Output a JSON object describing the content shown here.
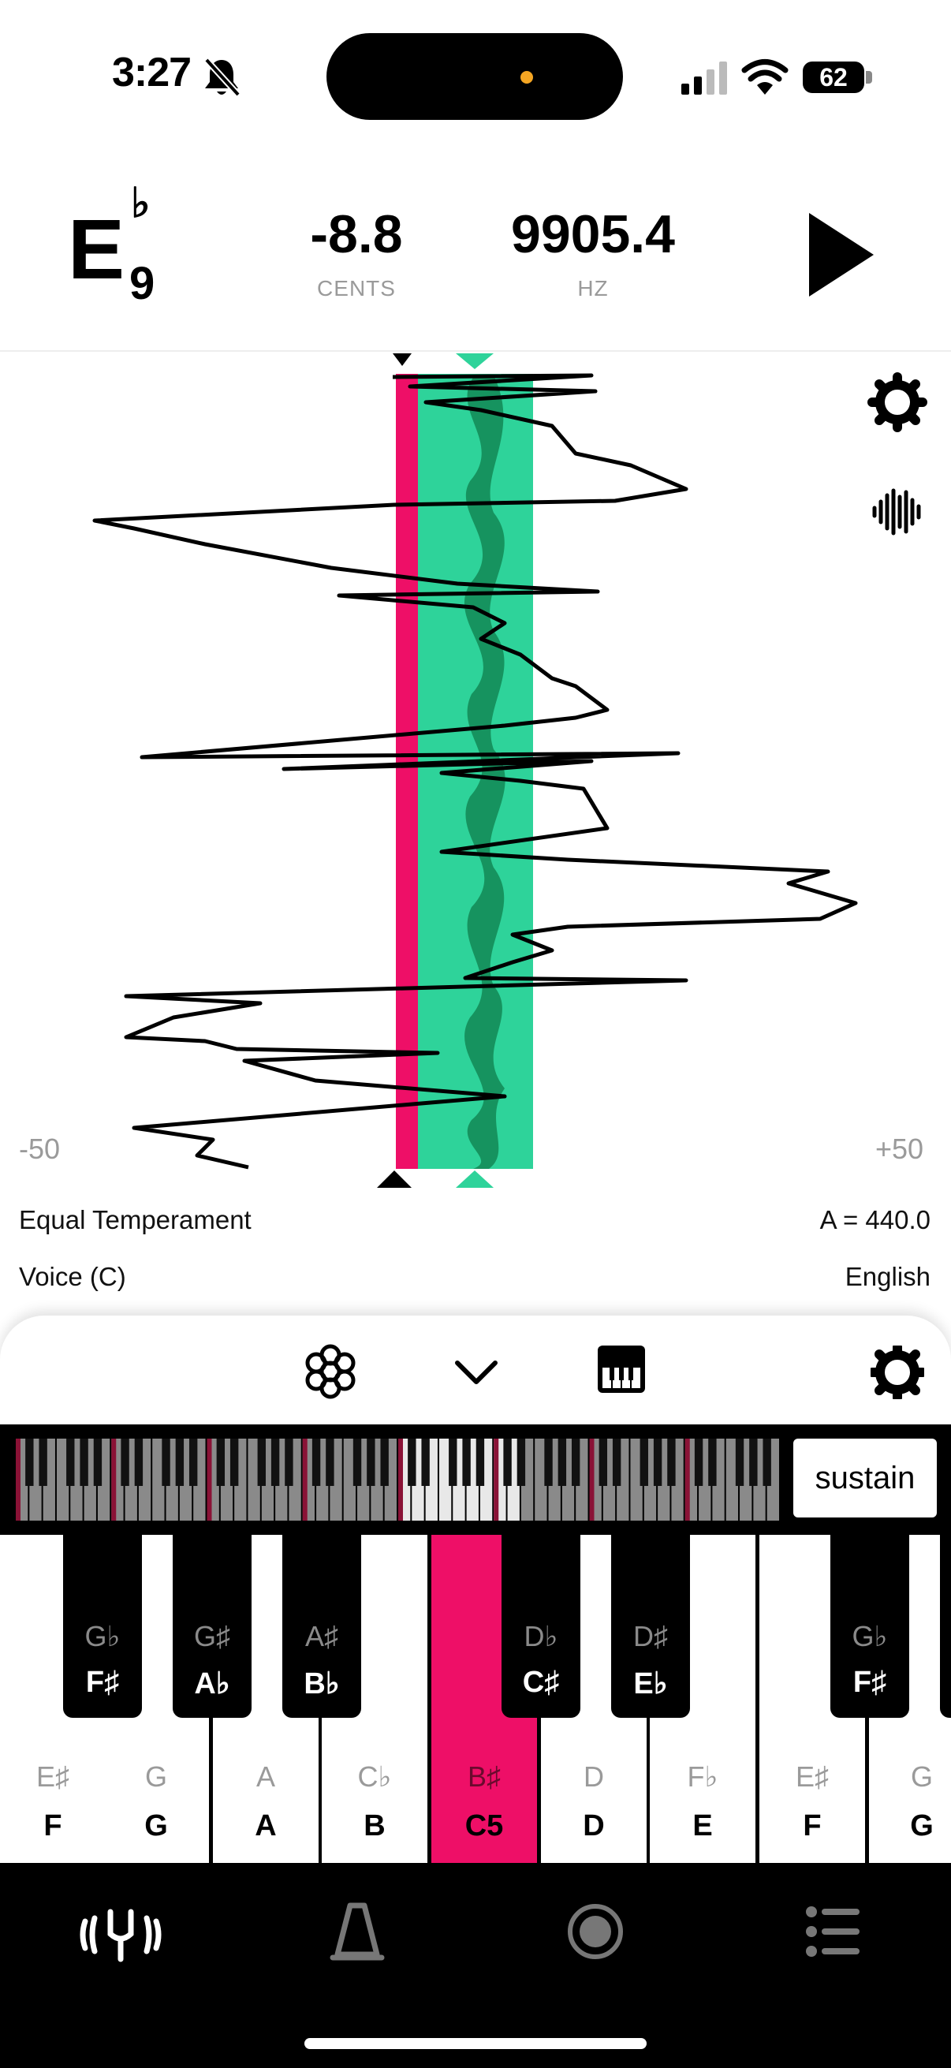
{
  "status_bar": {
    "time": "3:27",
    "battery": "62",
    "icons": [
      "bell-slash-icon",
      "signal-icon",
      "wifi-icon",
      "battery-icon"
    ]
  },
  "header": {
    "note": {
      "letter": "E",
      "accidental": "♭",
      "octave": "9"
    },
    "cents": {
      "value": "-8.8",
      "label": "CENTS"
    },
    "hz": {
      "value": "9905.4",
      "label": "HZ"
    },
    "play_icon": "play-icon"
  },
  "tuner": {
    "range_min": "-50",
    "range_max": "+50",
    "temperament": "Equal Temperament",
    "reference_pitch": "A = 440.0",
    "instrument": "Voice (C)",
    "language": "English",
    "colors": {
      "in_tune": "#2ed39a",
      "in_tune_dark": "#16935f",
      "current": "#ee0f67"
    }
  },
  "sheet": {
    "toolbar_icons": [
      "flower-icon",
      "chevron-down-icon",
      "piano-icon",
      "gear-icon"
    ],
    "sustain_label": "sustain"
  },
  "piano": {
    "white_keys": [
      {
        "alt": "E♯",
        "main": "F"
      },
      {
        "alt": "G",
        "main": "G"
      },
      {
        "alt": "A",
        "main": "A"
      },
      {
        "alt": "C♭",
        "main": "B"
      },
      {
        "alt": "B♯",
        "main": "C5",
        "active": true
      },
      {
        "alt": "D",
        "main": "D"
      },
      {
        "alt": "F♭",
        "main": "E"
      },
      {
        "alt": "E♯",
        "main": "F"
      },
      {
        "alt": "G",
        "main": "G"
      }
    ],
    "black_keys": [
      {
        "alt": "G♭",
        "main": "F♯"
      },
      {
        "alt": "G♯",
        "main": "A♭"
      },
      {
        "alt": "A♯",
        "main": "B♭"
      },
      {
        "alt": "D♭",
        "main": "C♯"
      },
      {
        "alt": "D♯",
        "main": "E♭"
      },
      {
        "alt": "G♭",
        "main": "F♯"
      }
    ]
  },
  "tab_bar": {
    "tabs": [
      "tuner-tab-icon",
      "metronome-tab-icon",
      "record-tab-icon",
      "list-tab-icon"
    ]
  }
}
